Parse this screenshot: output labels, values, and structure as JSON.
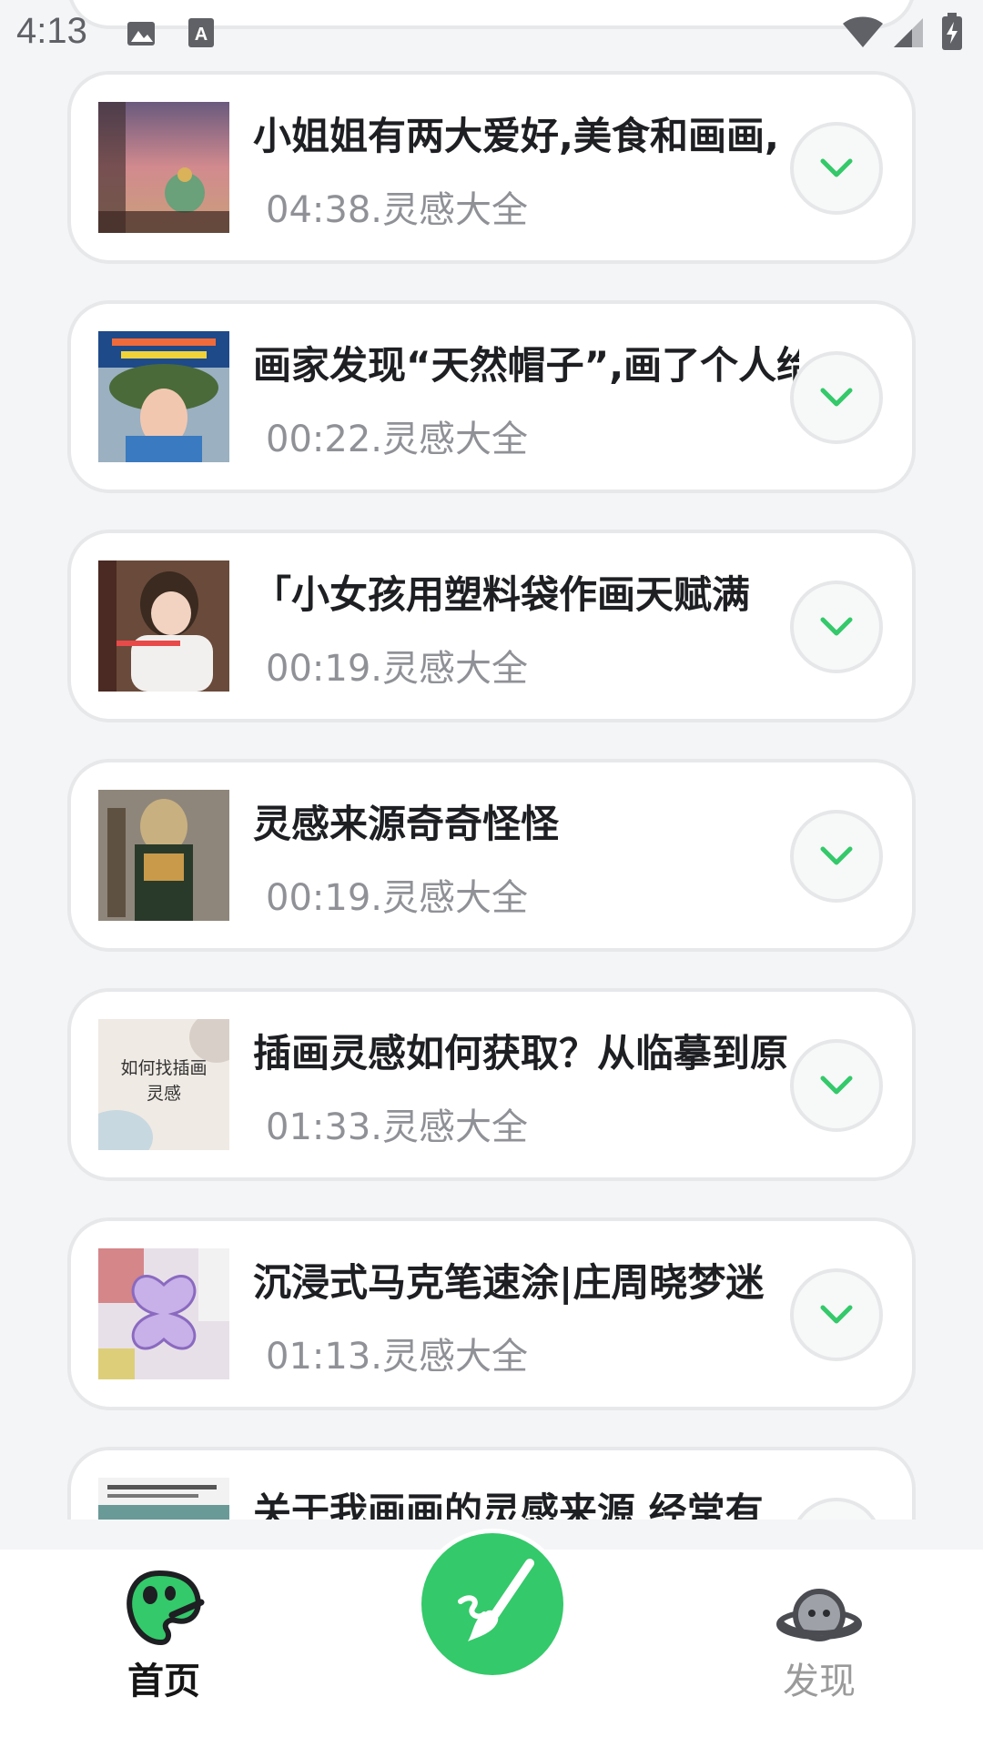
{
  "status_bar": {
    "time": "4:13",
    "icons": [
      "image-icon",
      "a-notification-icon",
      "wifi-icon",
      "signal-icon",
      "battery-icon"
    ]
  },
  "feed": {
    "items": [
      {
        "title": "小姐姐有两大爱好,美食和画画,",
        "meta": "04:38.灵感大全",
        "thumb": "painting-sunset"
      },
      {
        "title": "画家发现“天然帽子”,画了个人给",
        "meta": "00:22.灵感大全",
        "thumb": "girl-flower-crown"
      },
      {
        "title": "「小女孩用塑料袋作画天赋满",
        "meta": "00:19.灵感大全",
        "thumb": "little-girl"
      },
      {
        "title": "灵感来源奇奇怪怪",
        "meta": "00:19.灵感大全",
        "thumb": "armored-doll"
      },
      {
        "title": "插画灵感如何获取？从临摹到原",
        "meta": "01:33.灵感大全",
        "thumb": "illustration-tips",
        "thumb_text": "如何找插画\n灵感"
      },
      {
        "title": "沉浸式马克笔速涂|庄周晓梦迷",
        "meta": "01:13.灵感大全",
        "thumb": "butterfly-marker"
      },
      {
        "title": "关于我画画的灵感来源  经常有",
        "meta": "",
        "thumb": "sketchbook"
      }
    ]
  },
  "bottom_nav": {
    "home_label": "首页",
    "discover_label": "发现",
    "accent": "#34c96a"
  }
}
